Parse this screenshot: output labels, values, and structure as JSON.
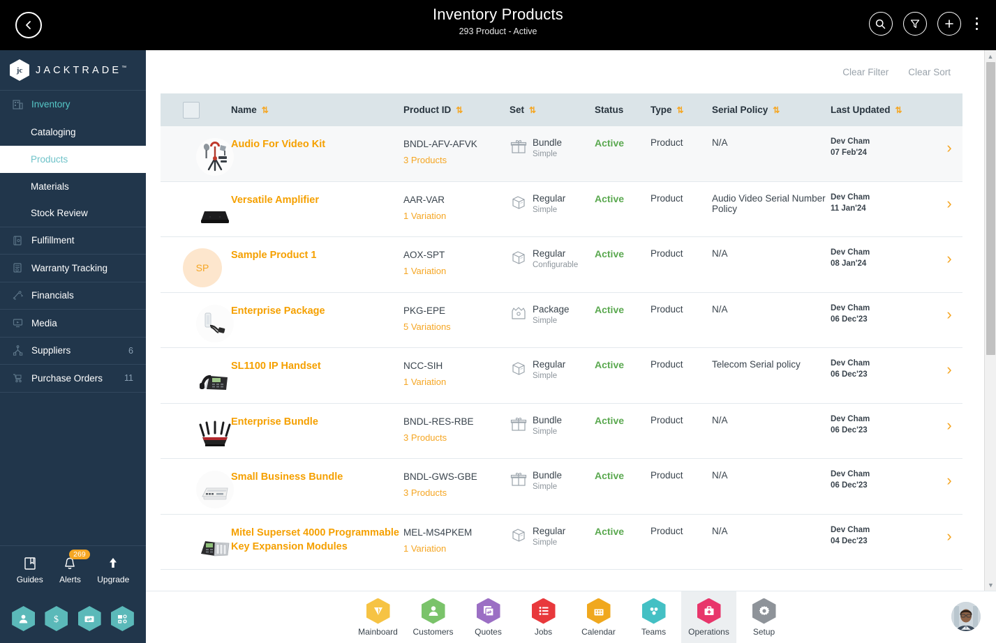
{
  "header": {
    "title": "Inventory Products",
    "subtitle": "293 Product - Active",
    "back_icon": "chevron-left-icon",
    "search_icon": "search-icon",
    "filter_icon": "filter-icon",
    "add_icon": "plus-icon",
    "more_icon": "more-vertical-icon"
  },
  "sidebar": {
    "logo_text": "JACKTRADE",
    "logo_tm": "™",
    "logo_mark": "jc",
    "items": [
      {
        "label": "Inventory",
        "icon": "inventory-icon",
        "type": "parent",
        "active": true
      },
      {
        "label": "Cataloging",
        "icon": "",
        "type": "sub"
      },
      {
        "label": "Products",
        "icon": "",
        "type": "sub",
        "selected": true
      },
      {
        "label": "Materials",
        "icon": "",
        "type": "sub"
      },
      {
        "label": "Stock Review",
        "icon": "",
        "type": "sub"
      },
      {
        "label": "Fulfillment",
        "icon": "fulfillment-icon",
        "type": "group"
      },
      {
        "label": "Warranty Tracking",
        "icon": "warranty-icon",
        "type": "group"
      },
      {
        "label": "Financials",
        "icon": "financials-icon",
        "type": "group"
      },
      {
        "label": "Media",
        "icon": "media-icon",
        "type": "group"
      },
      {
        "label": "Suppliers",
        "icon": "suppliers-icon",
        "type": "group",
        "count": "6"
      },
      {
        "label": "Purchase Orders",
        "icon": "purchase-orders-icon",
        "type": "group",
        "count": "11"
      }
    ],
    "utility": [
      {
        "label": "Guides",
        "icon": "book-icon"
      },
      {
        "label": "Alerts",
        "icon": "bell-icon",
        "badge": "269"
      },
      {
        "label": "Upgrade",
        "icon": "arrow-up-icon"
      }
    ],
    "quick_hexes": [
      {
        "icon": "user-icon"
      },
      {
        "icon": "dollar-icon"
      },
      {
        "icon": "payment-icon"
      },
      {
        "icon": "workflow-icon"
      }
    ]
  },
  "toolbar": {
    "clear_filter": "Clear Filter",
    "clear_sort": "Clear Sort"
  },
  "table": {
    "sort_glyph": "⇅",
    "columns": [
      {
        "key": "check",
        "label": "",
        "sortable": false
      },
      {
        "key": "name",
        "label": "Name",
        "sortable": true
      },
      {
        "key": "pid",
        "label": "Product ID",
        "sortable": true
      },
      {
        "key": "set",
        "label": "Set",
        "sortable": true
      },
      {
        "key": "status",
        "label": "Status",
        "sortable": false
      },
      {
        "key": "type",
        "label": "Type",
        "sortable": true
      },
      {
        "key": "serial",
        "label": "Serial Policy",
        "sortable": true
      },
      {
        "key": "updated",
        "label": "Last Updated",
        "sortable": true
      }
    ],
    "rows": [
      {
        "thumb_type": "photo",
        "thumb_icon": "audio-kit-thumb",
        "name": "Audio For Video Kit",
        "product_id": "BNDL-AFV-AFVK",
        "product_sub": "3 Products",
        "set": "Bundle",
        "set_sub": "Simple",
        "set_icon": "gift-box-icon",
        "status": "Active",
        "type": "Product",
        "serial_policy": "N/A",
        "updated_by": "Dev Cham",
        "updated_date": "07 Feb'24",
        "hovered": true
      },
      {
        "thumb_type": "photo",
        "thumb_icon": "amplifier-thumb",
        "name": "Versatile Amplifier",
        "product_id": "AAR-VAR",
        "product_sub": "1 Variation",
        "set": "Regular",
        "set_sub": "Simple",
        "set_icon": "box-icon",
        "status": "Active",
        "type": "Product",
        "serial_policy": "Audio Video Serial Number Policy",
        "updated_by": "Dev Cham",
        "updated_date": "11 Jan'24",
        "hovered": false
      },
      {
        "thumb_type": "initials",
        "thumb_initials": "SP",
        "name": "Sample Product 1",
        "product_id": "AOX-SPT",
        "product_sub": "1 Variation",
        "set": "Regular",
        "set_sub": "Configurable",
        "set_icon": "box-icon",
        "status": "Active",
        "type": "Product",
        "serial_policy": "N/A",
        "updated_by": "Dev Cham",
        "updated_date": "08 Jan'24",
        "hovered": false
      },
      {
        "thumb_type": "photo",
        "thumb_icon": "headset-thumb",
        "name": "Enterprise Package",
        "product_id": "PKG-EPE",
        "product_sub": "5 Variations",
        "set": "Package",
        "set_sub": "Simple",
        "set_icon": "package-icon",
        "status": "Active",
        "type": "Product",
        "serial_policy": "N/A",
        "updated_by": "Dev Cham",
        "updated_date": "06 Dec'23",
        "hovered": false
      },
      {
        "thumb_type": "photo",
        "thumb_icon": "ip-phone-thumb",
        "name": "SL1100 IP Handset",
        "product_id": "NCC-SIH",
        "product_sub": "1 Variation",
        "set": "Regular",
        "set_sub": "Simple",
        "set_icon": "box-icon",
        "status": "Active",
        "type": "Product",
        "serial_policy": "Telecom Serial policy",
        "updated_by": "Dev Cham",
        "updated_date": "06 Dec'23",
        "hovered": false
      },
      {
        "thumb_type": "photo",
        "thumb_icon": "router-thumb",
        "name": "Enterprise Bundle",
        "product_id": "BNDL-RES-RBE",
        "product_sub": "3 Products",
        "set": "Bundle",
        "set_sub": "Simple",
        "set_icon": "gift-box-icon",
        "status": "Active",
        "type": "Product",
        "serial_policy": "N/A",
        "updated_by": "Dev Cham",
        "updated_date": "06 Dec'23",
        "hovered": false
      },
      {
        "thumb_type": "photo",
        "thumb_icon": "switch-thumb",
        "name": "Small Business Bundle",
        "product_id": "BNDL-GWS-GBE",
        "product_sub": "3 Products",
        "set": "Bundle",
        "set_sub": "Simple",
        "set_icon": "gift-box-icon",
        "status": "Active",
        "type": "Product",
        "serial_policy": "N/A",
        "updated_by": "Dev Cham",
        "updated_date": "06 Dec'23",
        "hovered": false
      },
      {
        "thumb_type": "photo",
        "thumb_icon": "expansion-module-thumb",
        "name": "Mitel Superset 4000 Programmable Key Expansion Modules",
        "product_id": "MEL-MS4PKEM",
        "product_sub": "1 Variation",
        "set": "Regular",
        "set_sub": "Simple",
        "set_icon": "box-icon",
        "status": "Active",
        "type": "Product",
        "serial_policy": "N/A",
        "updated_by": "Dev Cham",
        "updated_date": "04 Dec'23",
        "hovered": false
      }
    ]
  },
  "bottom_nav": {
    "items": [
      {
        "label": "Mainboard",
        "icon": "mainboard-icon",
        "color": "#f6c344",
        "selected": false
      },
      {
        "label": "Customers",
        "icon": "customers-icon",
        "color": "#7ac36a",
        "selected": false
      },
      {
        "label": "Quotes",
        "icon": "quotes-icon",
        "color": "#9b6fc4",
        "selected": false
      },
      {
        "label": "Jobs",
        "icon": "jobs-icon",
        "color": "#e8393c",
        "selected": false
      },
      {
        "label": "Calendar",
        "icon": "calendar-icon",
        "color": "#f0a81e",
        "selected": false
      },
      {
        "label": "Teams",
        "icon": "teams-icon",
        "color": "#44c0c4",
        "selected": false
      },
      {
        "label": "Operations",
        "icon": "operations-icon",
        "color": "#e8366b",
        "selected": true
      },
      {
        "label": "Setup",
        "icon": "setup-icon",
        "color": "#8e9399",
        "selected": false
      }
    ],
    "avatar": "user-avatar"
  },
  "colors": {
    "accent_orange": "#f5a623",
    "sidebar_bg": "#21364b",
    "active_green": "#5aa84f",
    "header_bg": "#dbe4e8"
  }
}
